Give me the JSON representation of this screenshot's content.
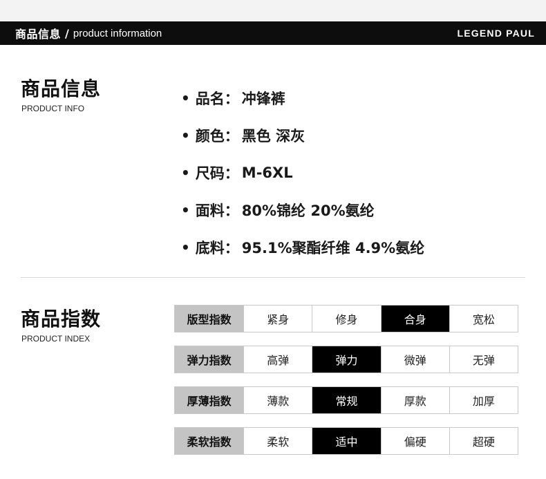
{
  "header": {
    "title_cn": "商品信息",
    "separator": "/",
    "title_en": "product information",
    "brand": "LEGEND PAUL"
  },
  "info_section": {
    "title": "商品信息",
    "subtitle": "PRODUCT INFO",
    "items": [
      {
        "label": "品名：",
        "value": "冲锋裤"
      },
      {
        "label": "颜色：",
        "value": "黑色 深灰"
      },
      {
        "label": "尺码：",
        "value": "M-6XL"
      },
      {
        "label": "面料：",
        "value": "80%锦纶 20%氨纶"
      },
      {
        "label": "底料：",
        "value": "95.1%聚酯纤维 4.9%氨纶"
      }
    ]
  },
  "index_section": {
    "title": "商品指数",
    "subtitle": "PRODUCT INDEX",
    "rows": [
      {
        "name": "版型指数",
        "options": [
          "紧身",
          "修身",
          "合身",
          "宽松"
        ],
        "selected": 2
      },
      {
        "name": "弹力指数",
        "options": [
          "高弹",
          "弹力",
          "微弹",
          "无弹"
        ],
        "selected": 1
      },
      {
        "name": "厚薄指数",
        "options": [
          "薄款",
          "常规",
          "厚款",
          "加厚"
        ],
        "selected": 1
      },
      {
        "name": "柔软指数",
        "options": [
          "柔软",
          "适中",
          "偏硬",
          "超硬"
        ],
        "selected": 1
      }
    ]
  },
  "colors": {
    "header_bg": "#0d0d0d",
    "row_label_bg": "#c4c4c4",
    "selected_bg": "#000000",
    "selected_text": "#ffffff"
  }
}
